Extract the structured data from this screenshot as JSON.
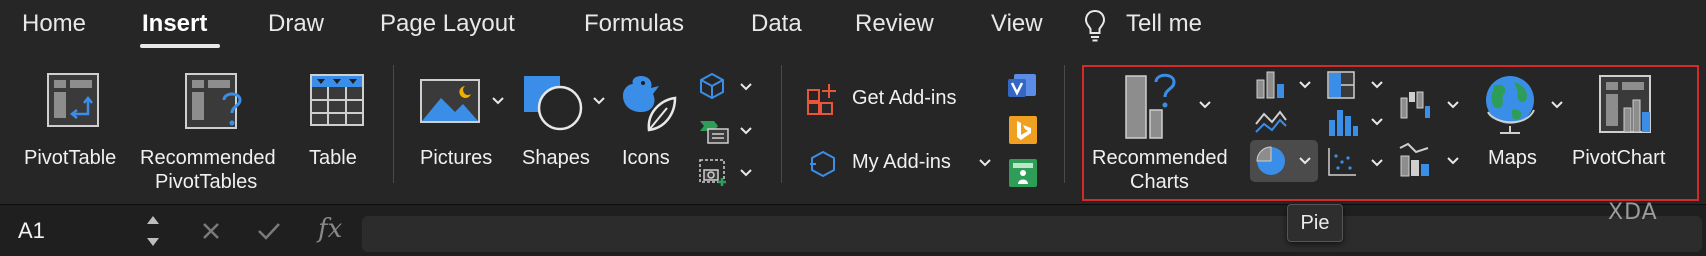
{
  "tabs": [
    {
      "label": "Home"
    },
    {
      "label": "Insert"
    },
    {
      "label": "Draw"
    },
    {
      "label": "Page Layout"
    },
    {
      "label": "Formulas"
    },
    {
      "label": "Data"
    },
    {
      "label": "Review"
    },
    {
      "label": "View"
    }
  ],
  "tell_me": "Tell me",
  "ribbon": {
    "pivot_table": "PivotTable",
    "recommended_pivot_line1": "Recommended",
    "recommended_pivot_line2": "PivotTables",
    "table": "Table",
    "pictures": "Pictures",
    "shapes": "Shapes",
    "icons": "Icons",
    "get_addins": "Get Add-ins",
    "my_addins": "My Add-ins",
    "recommended_charts_line1": "Recommended",
    "recommended_charts_line2": "Charts",
    "maps": "Maps",
    "pivot_chart": "PivotChart"
  },
  "formula_bar": {
    "name_box": "A1",
    "fx": "fx",
    "value": ""
  },
  "tooltip": "Pie",
  "watermark": "XDA",
  "colors": {
    "accent_blue": "#3b8ee8",
    "addin_orange": "#e8553a",
    "highlight_red": "#d42a2a",
    "visio_blue": "#3566c2",
    "bing_orange": "#f0a020",
    "people_green": "#2e9d57"
  },
  "icons": [
    "pivot-table-icon",
    "recommended-pivot-icon",
    "table-icon",
    "pictures-icon",
    "shapes-icon",
    "icons-icon",
    "3d-models-icon",
    "smartart-icon",
    "screenshot-icon",
    "addins-store-icon",
    "my-addins-icon",
    "visio-icon",
    "bing-maps-icon",
    "people-graph-icon",
    "recommended-charts-icon",
    "column-chart-icon",
    "line-chart-icon",
    "pie-chart-icon",
    "hierarchy-chart-icon",
    "statistic-chart-icon",
    "scatter-chart-icon",
    "waterfall-chart-icon",
    "combo-chart-icon",
    "maps-icon",
    "pivot-chart-icon"
  ]
}
